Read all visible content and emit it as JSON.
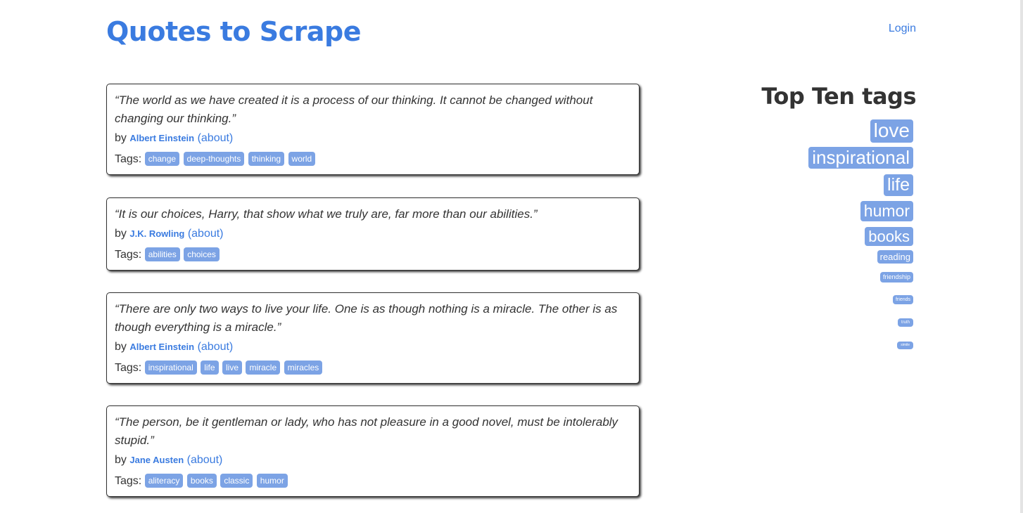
{
  "header": {
    "site_title": "Quotes to Scrape",
    "login_label": "Login"
  },
  "quotes": [
    {
      "text": "“The world as we have created it is a process of our thinking. It cannot be changed without changing our thinking.”",
      "by_label": "by",
      "author": "Albert Einstein",
      "about_label": "(about)",
      "tags_label": "Tags:",
      "tags": [
        "change",
        "deep-thoughts",
        "thinking",
        "world"
      ]
    },
    {
      "text": "“It is our choices, Harry, that show what we truly are, far more than our abilities.”",
      "by_label": "by",
      "author": "J.K. Rowling",
      "about_label": "(about)",
      "tags_label": "Tags:",
      "tags": [
        "abilities",
        "choices"
      ]
    },
    {
      "text": "“There are only two ways to live your life. One is as though nothing is a miracle. The other is as though everything is a miracle.”",
      "by_label": "by",
      "author": "Albert Einstein",
      "about_label": "(about)",
      "tags_label": "Tags:",
      "tags": [
        "inspirational",
        "life",
        "live",
        "miracle",
        "miracles"
      ]
    },
    {
      "text": "“The person, be it gentleman or lady, who has not pleasure in a good novel, must be intolerably stupid.”",
      "by_label": "by",
      "author": "Jane Austen",
      "about_label": "(about)",
      "tags_label": "Tags:",
      "tags": [
        "aliteracy",
        "books",
        "classic",
        "humor"
      ]
    }
  ],
  "sidebar": {
    "title": "Top Ten tags",
    "tags": [
      "love",
      "inspirational",
      "life",
      "humor",
      "books",
      "reading",
      "friendship",
      "friends",
      "truth",
      "simile"
    ]
  },
  "colors": {
    "accent": "#3a7be0",
    "tag_background": "#7ca3e5",
    "text": "#333333"
  }
}
